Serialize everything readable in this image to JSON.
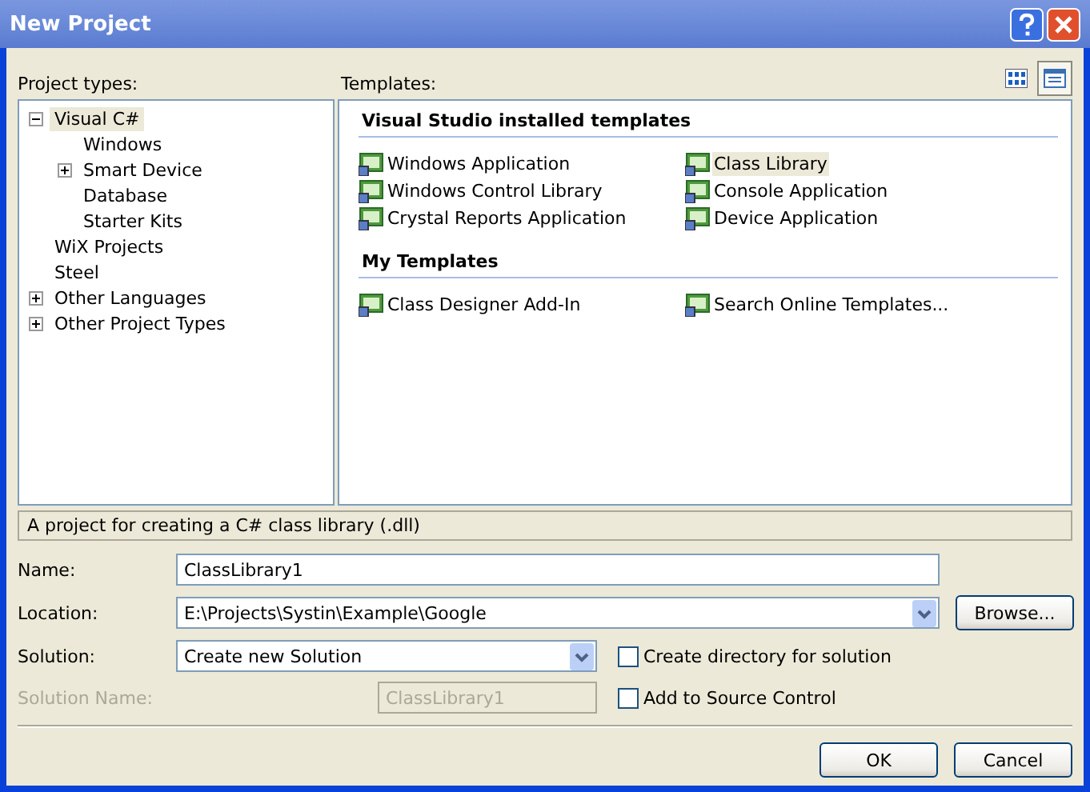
{
  "window": {
    "title": "New Project"
  },
  "project_types": {
    "label": "Project types:",
    "tree": [
      {
        "label": "Visual C#",
        "expanded": true,
        "selected": true,
        "children": [
          {
            "label": "Windows",
            "selected": false
          },
          {
            "label": "Smart Device",
            "expanded": false,
            "selected": false
          },
          {
            "label": "Database",
            "selected": false
          },
          {
            "label": "Starter Kits",
            "selected": false
          }
        ]
      },
      {
        "label": "WiX Projects",
        "selected": false
      },
      {
        "label": "Steel",
        "selected": false
      },
      {
        "label": "Other Languages",
        "expanded": false,
        "selected": false
      },
      {
        "label": "Other Project Types",
        "expanded": false,
        "selected": false
      }
    ]
  },
  "templates": {
    "label": "Templates:",
    "view_buttons": [
      {
        "kind": "large",
        "selected": false
      },
      {
        "kind": "small",
        "selected": true
      }
    ],
    "groups": [
      {
        "title": "Visual Studio installed templates",
        "items": [
          {
            "label": "Windows Application",
            "selected": false
          },
          {
            "label": "Class Library",
            "selected": true
          },
          {
            "label": "Windows Control Library",
            "selected": false
          },
          {
            "label": "Console Application",
            "selected": false
          },
          {
            "label": "Crystal Reports Application",
            "selected": false
          },
          {
            "label": "Device Application",
            "selected": false
          }
        ]
      },
      {
        "title": "My Templates",
        "items": [
          {
            "label": "Class Designer Add-In",
            "selected": false
          },
          {
            "label": "Search Online Templates...",
            "selected": false
          }
        ]
      }
    ]
  },
  "description": "A project for creating a C# class library (.dll)",
  "form": {
    "name": {
      "label": "Name:",
      "value": "ClassLibrary1"
    },
    "location": {
      "label": "Location:",
      "value": "E:\\Projects\\Systin\\Example\\Google",
      "browse": "Browse..."
    },
    "solution": {
      "label": "Solution:",
      "value": "Create new Solution"
    },
    "solution_name": {
      "label": "Solution Name:",
      "value": "ClassLibrary1",
      "disabled": true
    },
    "create_directory": {
      "label": "Create directory for solution",
      "checked": false
    },
    "source_control": {
      "label": "Add to Source Control",
      "checked": false
    }
  },
  "buttons": [
    {
      "label": "OK"
    },
    {
      "label": "Cancel"
    }
  ]
}
